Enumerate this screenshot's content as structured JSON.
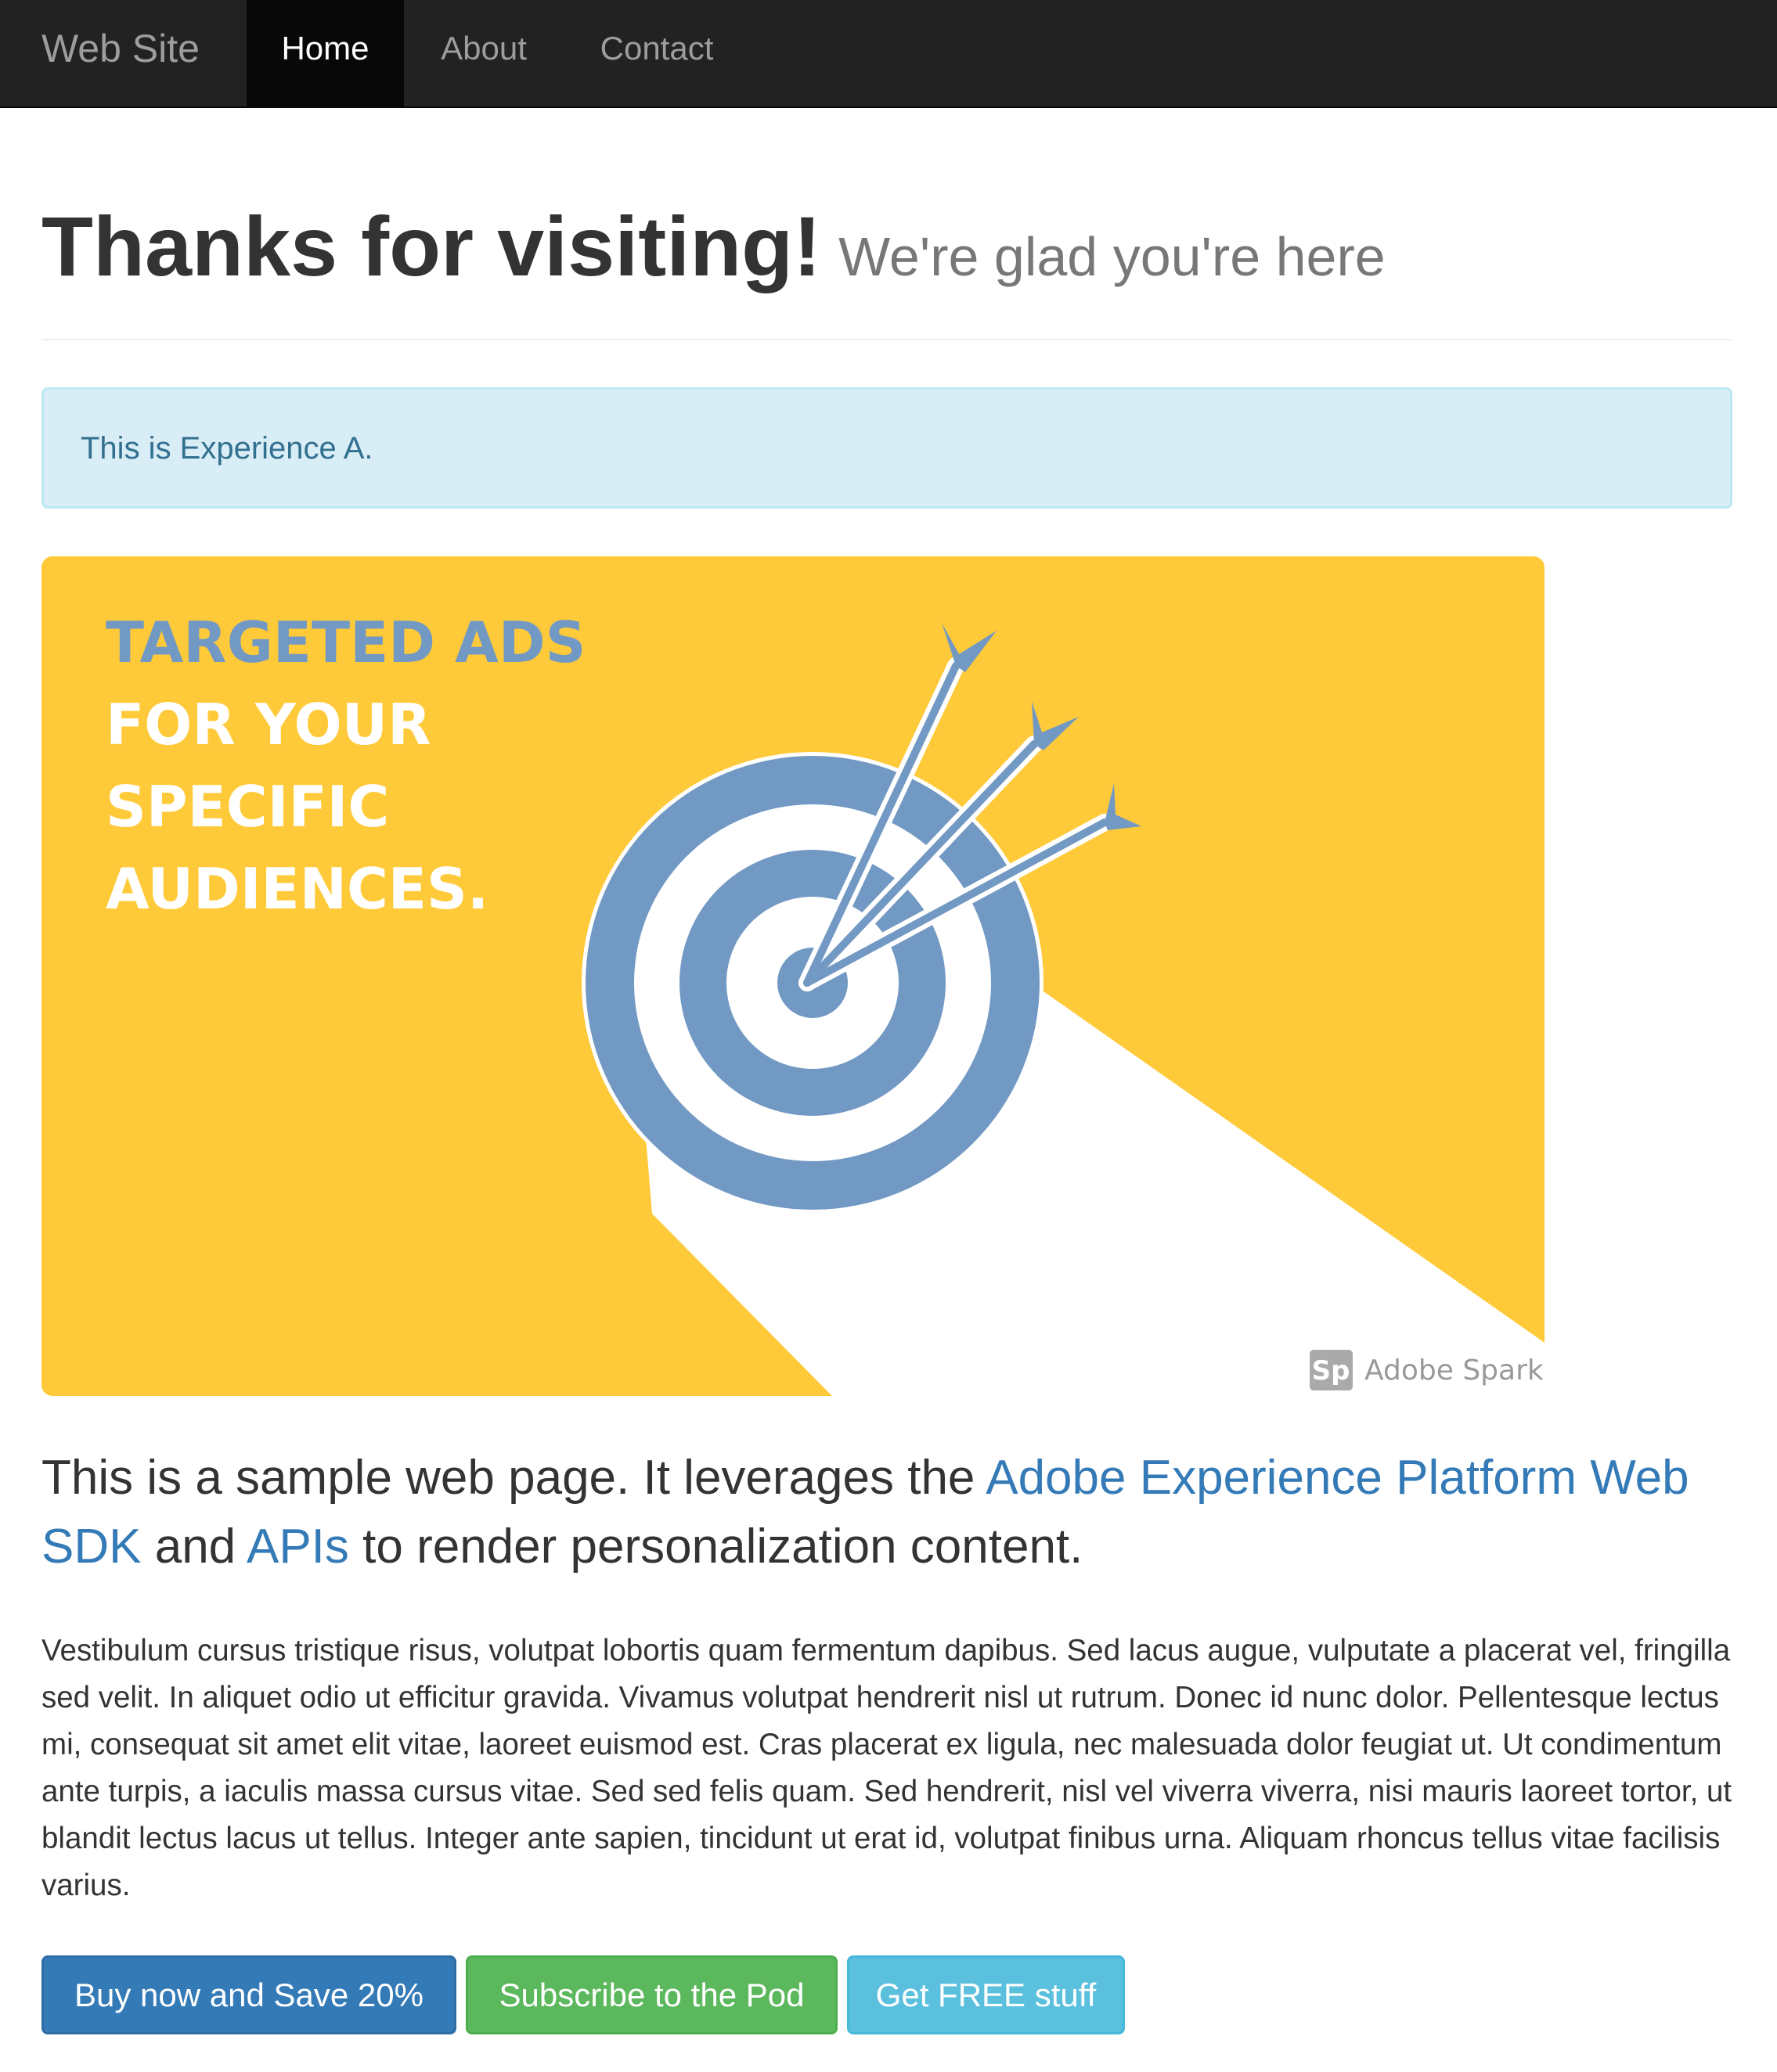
{
  "navbar": {
    "brand": "Web Site",
    "items": [
      {
        "label": "Home",
        "active": true
      },
      {
        "label": "About",
        "active": false
      },
      {
        "label": "Contact",
        "active": false
      }
    ]
  },
  "header": {
    "title": "Thanks for visiting!",
    "subtitle": "We're glad you're here"
  },
  "alert": {
    "text": "This is Experience A."
  },
  "ad": {
    "headline_lines": [
      "TARGETED ADS",
      "FOR YOUR",
      "SPECIFIC",
      "AUDIENCES."
    ],
    "watermark_logo": "Sp",
    "watermark_text": "Adobe Spark",
    "colors": {
      "background": "#ffca3a",
      "target": "#7299c3",
      "headline_accent": "#7299c3",
      "headline": "#ffffff"
    }
  },
  "lead": {
    "text_1": "This is a sample web page. It leverages the ",
    "link_1": "Adobe Experience Platform Web SDK",
    "text_2": " and ",
    "link_2": "APIs",
    "text_3": " to render personalization content."
  },
  "body": {
    "paragraph": "Vestibulum cursus tristique risus, volutpat lobortis quam fermentum dapibus. Sed lacus augue, vulputate a placerat vel, fringilla sed velit. In aliquet odio ut efficitur gravida. Vivamus volutpat hendrerit nisl ut rutrum. Donec id nunc dolor. Pellentesque lectus mi, consequat sit amet elit vitae, laoreet euismod est. Cras placerat ex ligula, nec malesuada dolor feugiat ut. Ut condimentum ante turpis, a iaculis massa cursus vitae. Sed sed felis quam. Sed hendrerit, nisl vel viverra viverra, nisi mauris laoreet tortor, ut blandit lectus lacus ut tellus. Integer ante sapien, tincidunt ut erat id, volutpat finibus urna. Aliquam rhoncus tellus vitae facilisis varius."
  },
  "buttons": {
    "buy": "Buy now and Save 20%",
    "subscribe": "Subscribe to the Pod",
    "free": "Get FREE stuff"
  },
  "colors": {
    "navbar_bg": "#222222",
    "link": "#337ab7",
    "alert_bg": "#d9edf7",
    "alert_text": "#31708f",
    "primary": "#337ab7",
    "success": "#5cb85c",
    "info": "#5bc0de"
  }
}
